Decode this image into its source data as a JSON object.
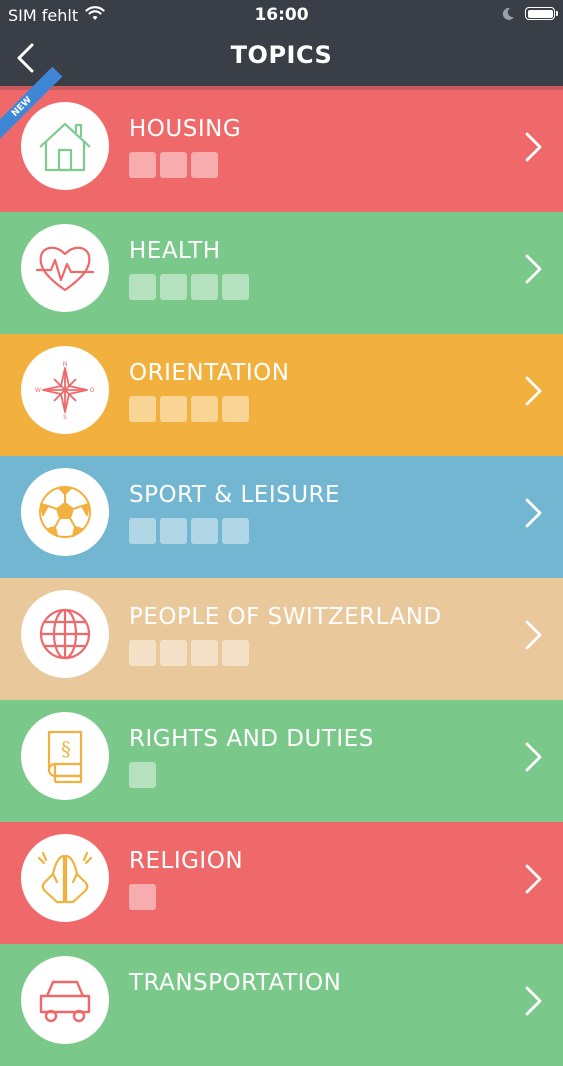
{
  "status_bar": {
    "carrier": "SIM fehlt",
    "time": "16:00"
  },
  "nav": {
    "title": "TOPICS"
  },
  "ribbon": {
    "label": "NEW"
  },
  "topics": [
    {
      "label": "HOUSING",
      "bg": "#f0696a",
      "icon": "house-icon",
      "icon_color": "#7dcb8d",
      "progress_boxes": 3
    },
    {
      "label": "HEALTH",
      "bg": "#7bc98a",
      "icon": "heart-pulse-icon",
      "icon_color": "#f0696a",
      "progress_boxes": 4
    },
    {
      "label": "ORIENTATION",
      "bg": "#f2b13e",
      "icon": "compass-icon",
      "icon_color": "#f0696a",
      "progress_boxes": 4
    },
    {
      "label": "SPORT & LEISURE",
      "bg": "#72b6d2",
      "icon": "soccer-ball-icon",
      "icon_color": "#f2b13e",
      "progress_boxes": 4
    },
    {
      "label": "PEOPLE OF SWITZERLAND",
      "bg": "#e9c89c",
      "icon": "globe-icon",
      "icon_color": "#f0696a",
      "progress_boxes": 4
    },
    {
      "label": "RIGHTS AND DUTIES",
      "bg": "#7bc98a",
      "icon": "law-book-icon",
      "icon_color": "#f2b13e",
      "progress_boxes": 1
    },
    {
      "label": "RELIGION",
      "bg": "#f0696a",
      "icon": "praying-hands-icon",
      "icon_color": "#f2b13e",
      "progress_boxes": 1
    },
    {
      "label": "TRANSPORTATION",
      "bg": "#7bc98a",
      "icon": "vehicle-icon",
      "icon_color": "#f0696a",
      "progress_boxes": 0
    }
  ]
}
